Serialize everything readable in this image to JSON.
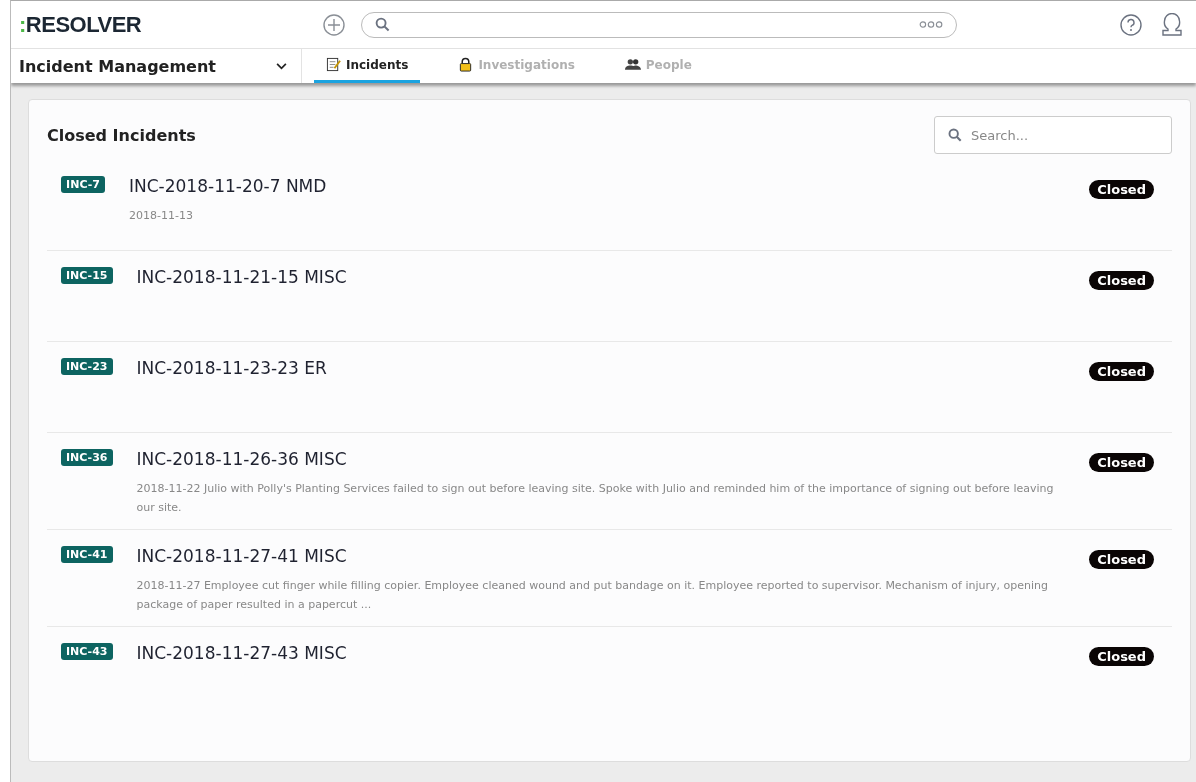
{
  "header": {
    "logo": {
      "mark": ":",
      "name": "RESOLVER"
    }
  },
  "nav": {
    "app_name": "Incident Management",
    "tabs": [
      {
        "label": "Incidents",
        "selected": true
      },
      {
        "label": "Investigations",
        "selected": false
      },
      {
        "label": "People",
        "selected": false
      }
    ]
  },
  "panel": {
    "title": "Closed Incidents",
    "search": {
      "placeholder": "Search..."
    },
    "items": [
      {
        "id": "INC-7",
        "title": "INC-2018-11-20-7 NMD",
        "description": "2018-11-13",
        "status": "Closed"
      },
      {
        "id": "INC-15",
        "title": "INC-2018-11-21-15 MISC",
        "status": "Closed"
      },
      {
        "id": "INC-23",
        "title": "INC-2018-11-23-23 ER",
        "status": "Closed"
      },
      {
        "id": "INC-36",
        "title": "INC-2018-11-26-36 MISC",
        "description": "2018-11-22 Julio with Polly's Planting Services failed to sign out before leaving site. Spoke with Julio and reminded him of the importance of signing out before leaving our site.",
        "status": "Closed"
      },
      {
        "id": "INC-41",
        "title": "INC-2018-11-27-41 MISC",
        "description": "2018-11-27 Employee cut finger while filling copier. Employee cleaned wound and put bandage on it. Employee reported to supervisor. Mechanism of injury, opening package of paper resulted in a papercut ...",
        "status": "Closed"
      },
      {
        "id": "INC-43",
        "title": "INC-2018-11-27-43 MISC",
        "status": "Closed"
      }
    ]
  }
}
